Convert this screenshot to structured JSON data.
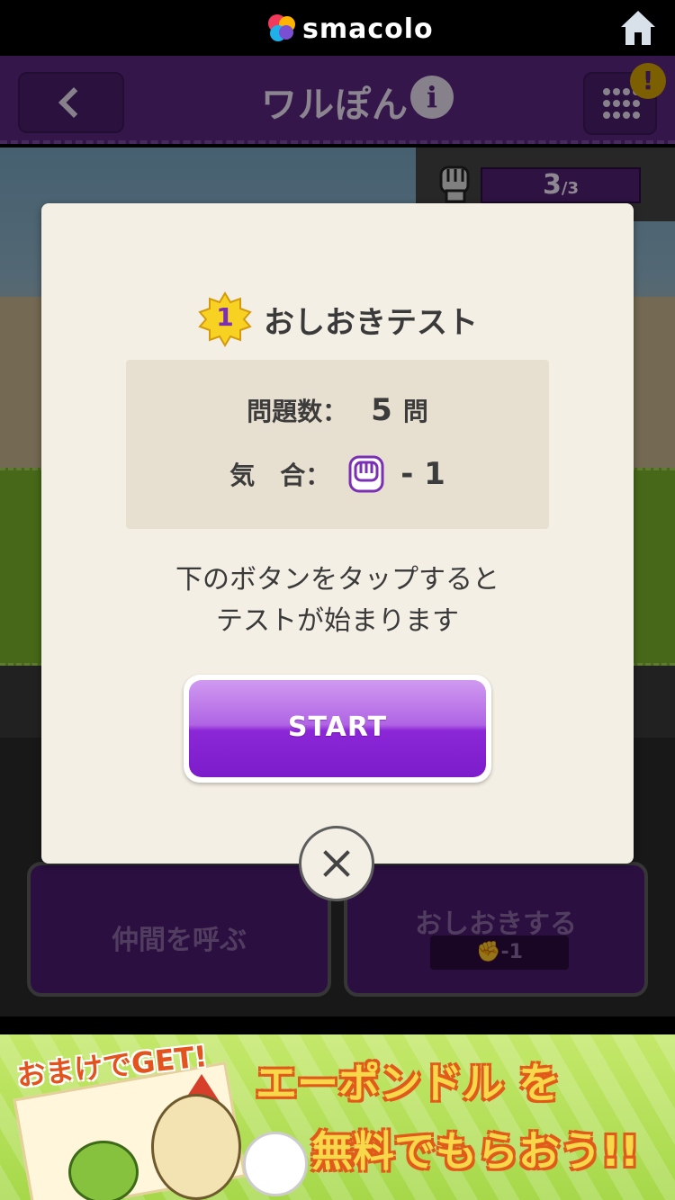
{
  "statusbar": {
    "brand": "smacolo",
    "home_icon": "home-icon"
  },
  "header": {
    "back_icon": "chevron-left-icon",
    "app_title": "ワルぽん",
    "info_icon": "info-icon",
    "info_glyph": "i",
    "menu_icon": "grid-menu-icon",
    "alert_badge": "!"
  },
  "stamina": {
    "icon": "fist-icon",
    "current": "3",
    "separator": "/",
    "max": "3"
  },
  "actions": {
    "call_friends": "仲間を呼ぶ",
    "punish": "おしおきする",
    "punish_cost": "-1",
    "punish_cost_icon": "fist-icon"
  },
  "modal": {
    "level": "1",
    "title": "おしおきテスト",
    "questions_label": "問題数：",
    "questions_value": "5",
    "questions_unit": "問",
    "spirit_label": "気　合：",
    "spirit_icon": "fist-icon",
    "spirit_value": "- 1",
    "description_line1": "下のボタンをタップすると",
    "description_line2": "テストが始まります",
    "start_label": "START",
    "close_icon": "close-icon"
  },
  "ad": {
    "bonus": "おまけでGET!",
    "line1": "エーポンドル を",
    "line2": "無料でもらおう!!"
  },
  "colors": {
    "header_purple": "#5a2782",
    "start_purple": "#8b27d6",
    "modal_bg": "#f4efe4",
    "ad_green": "#a6d84a"
  }
}
